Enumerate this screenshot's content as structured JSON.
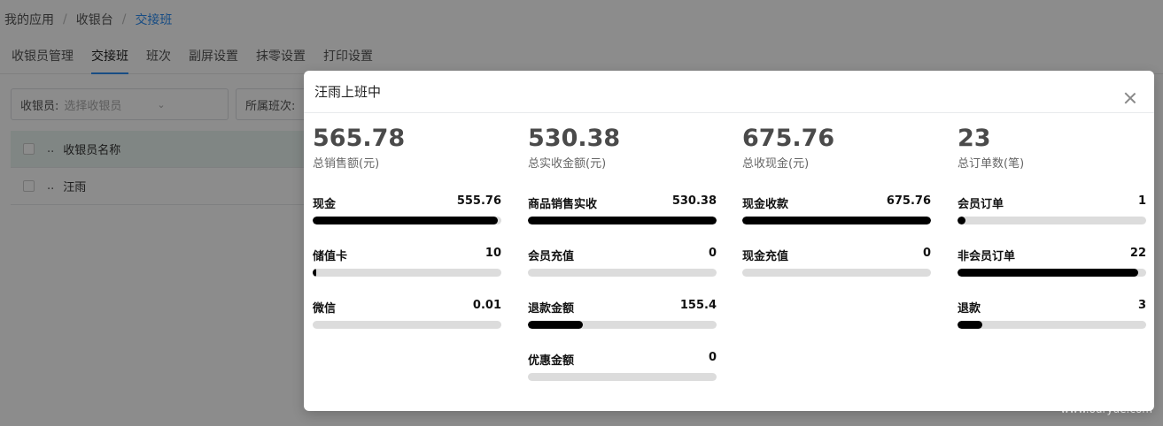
{
  "breadcrumb": {
    "items": [
      "我的应用",
      "收银台",
      "交接班"
    ],
    "sep": "/"
  },
  "tabs": [
    "收银员管理",
    "交接班",
    "班次",
    "副屏设置",
    "抹零设置",
    "打印设置"
  ],
  "filters": {
    "cashier_label": "收银员:",
    "cashier_placeholder": "选择收银员",
    "shift_label": "所属班次:"
  },
  "table": {
    "header": {
      "dots": "..",
      "name": "收银员名称"
    },
    "rows": [
      {
        "dots": "..",
        "name": "汪雨"
      }
    ]
  },
  "modal": {
    "title": "汪雨上班中",
    "columns": [
      {
        "big": "565.78",
        "sub": "总销售额(元)",
        "items": [
          {
            "label": "现金",
            "value": "555.76",
            "progress": 0.98
          },
          {
            "label": "储值卡",
            "value": "10",
            "progress": 0.018
          },
          {
            "label": "微信",
            "value": "0.01",
            "progress": 0
          }
        ]
      },
      {
        "big": "530.38",
        "sub": "总实收金额(元)",
        "items": [
          {
            "label": "商品销售实收",
            "value": "530.38",
            "progress": 1
          },
          {
            "label": "会员充值",
            "value": "0",
            "progress": 0
          },
          {
            "label": "退款金额",
            "value": "155.4",
            "progress": 0.29
          },
          {
            "label": "优惠金额",
            "value": "0",
            "progress": 0
          }
        ]
      },
      {
        "big": "675.76",
        "sub": "总收现金(元)",
        "items": [
          {
            "label": "现金收款",
            "value": "675.76",
            "progress": 1
          },
          {
            "label": "现金充值",
            "value": "0",
            "progress": 0
          }
        ]
      },
      {
        "big": "23",
        "sub": "总订单数(笔)",
        "items": [
          {
            "label": "会员订单",
            "value": "1",
            "progress": 0.043
          },
          {
            "label": "非会员订单",
            "value": "22",
            "progress": 0.957
          },
          {
            "label": "退款",
            "value": "3",
            "progress": 0.13
          }
        ]
      }
    ]
  },
  "watermark": "www.ouryue.com",
  "colors": {
    "accent": "#2d8cf0",
    "bar_fill": "#000000",
    "bar_track": "#dcdcdc"
  }
}
